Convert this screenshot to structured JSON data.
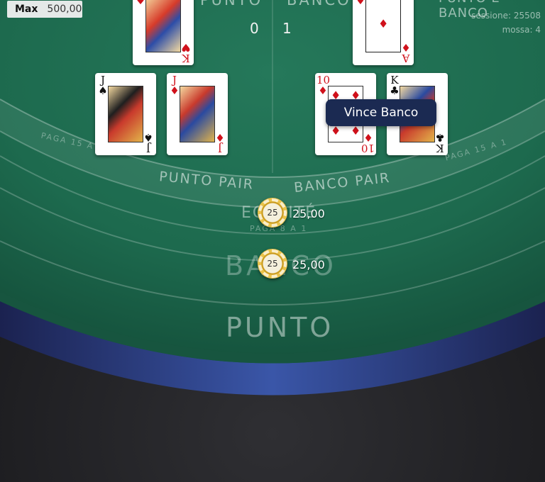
{
  "limits": {
    "max_label": "Max",
    "max_value": "500,00"
  },
  "headers": {
    "punto": "PUNTO",
    "banco": "BANCO",
    "punto_e_banco": "PUNTO E BANCO",
    "punto_score": "0",
    "banco_score": "1",
    "session": "sessione: 25508",
    "move": "mossa: 4"
  },
  "result": {
    "label": "Vince Banco"
  },
  "zones": {
    "punto_pair": "PUNTO PAIR",
    "banco_pair": "BANCO PAIR",
    "pays_left": "PAGA 15 A 1",
    "pays_right": "PAGA 15 A 1",
    "egalite": "EGALITÉ",
    "egalite_pays": "PAGA 8 A 1",
    "banco": "BANCO",
    "punto": "PUNTO"
  },
  "bets": [
    {
      "zone": "egalite",
      "chip": "25",
      "amount": "25,00"
    },
    {
      "zone": "banco",
      "chip": "25",
      "amount": "25,00"
    }
  ],
  "cards": {
    "punto": [
      {
        "rank": "K",
        "suit": "♥",
        "color": "red"
      },
      {
        "rank": "J",
        "suit": "♠",
        "color": "black"
      },
      {
        "rank": "J",
        "suit": "♦",
        "color": "red"
      }
    ],
    "banco": [
      {
        "rank": "A",
        "suit": "♦",
        "color": "red"
      },
      {
        "rank": "10",
        "suit": "♦",
        "color": "red"
      },
      {
        "rank": "K",
        "suit": "♣",
        "color": "black"
      }
    ]
  },
  "colors": {
    "felt": "#1f6b4f",
    "felt_dark": "#135339",
    "rim": "#2b3f7a",
    "floor": "#1c1c1f",
    "chip_gold": "#e9c24a",
    "badge_bg": "#1b2a52"
  }
}
